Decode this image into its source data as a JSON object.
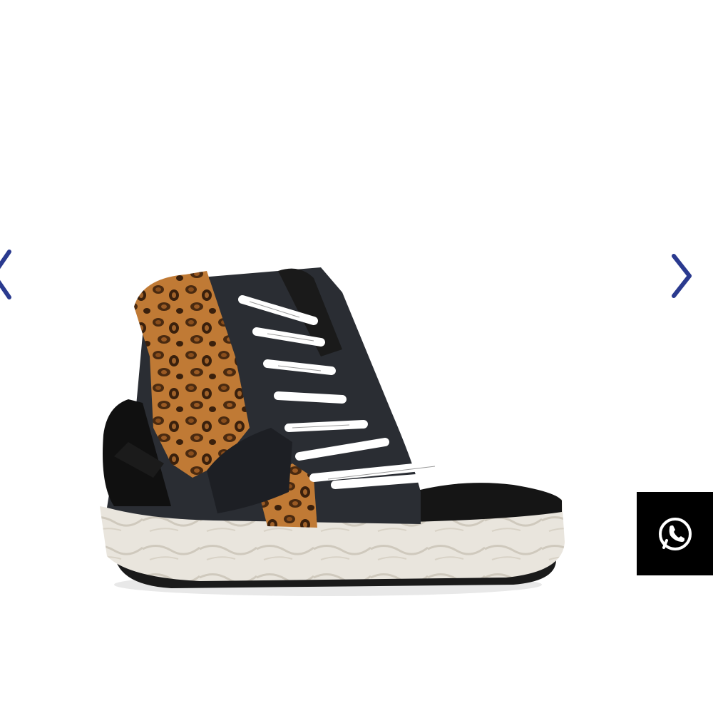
{
  "gallery": {
    "image_subject": "shoe-image",
    "prev_icon": "chevron-left-icon",
    "next_icon": "chevron-right-icon",
    "accent_color": "#2a3a8f"
  },
  "contact": {
    "icon": "whatsapp-icon",
    "background_color": "#000000"
  }
}
